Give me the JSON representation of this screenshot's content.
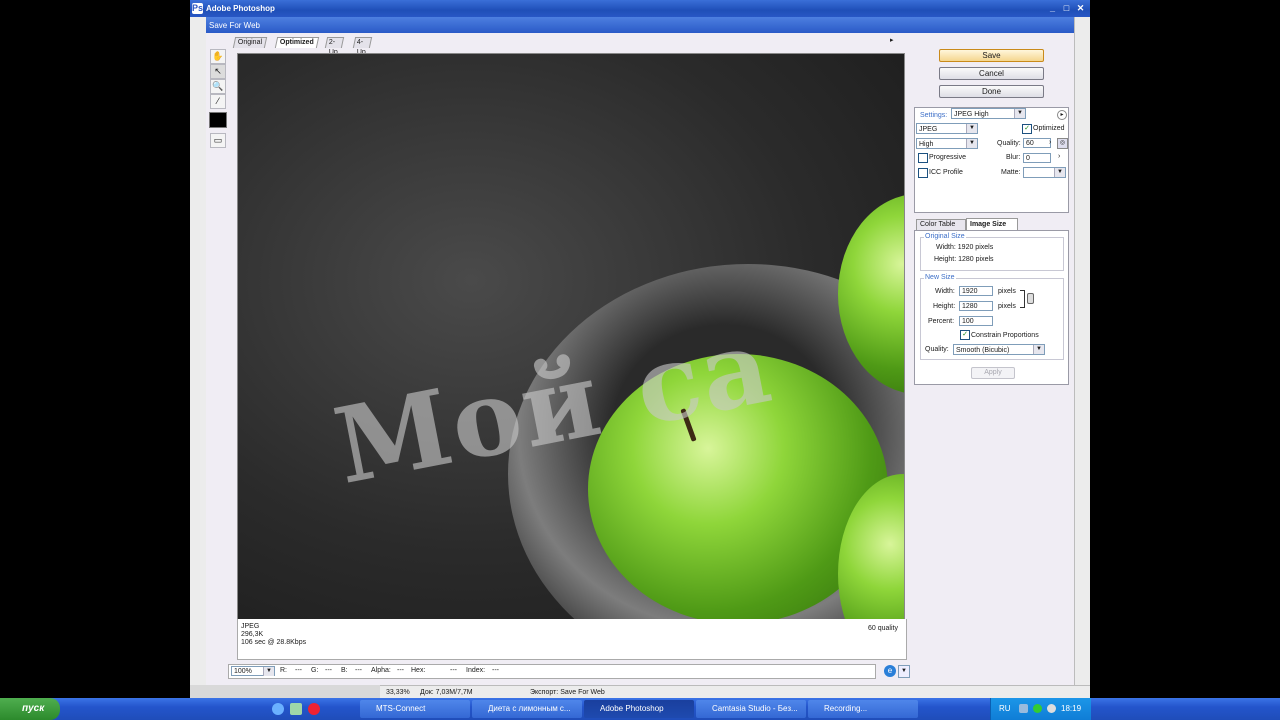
{
  "app": {
    "title": "Adobe Photoshop"
  },
  "dialog": {
    "title": "Save For Web",
    "tabs": [
      "Original",
      "Optimized",
      "2-Up",
      "4-Up"
    ],
    "preview": {
      "watermark": "Мой са"
    },
    "info_left": [
      "JPEG",
      "296,3K",
      "106 sec @ 28.8Kbps"
    ],
    "info_right": "60 quality",
    "status": {
      "zoom": "100%",
      "r_label": "R:",
      "r_val": "---",
      "g_label": "G:",
      "g_val": "---",
      "b_label": "B:",
      "b_val": "---",
      "alpha_label": "Alpha:",
      "alpha_val": "---",
      "hex_label": "Hex:",
      "hex_val": "---",
      "index_label": "Index:",
      "index_val": "---"
    },
    "buttons": {
      "save": "Save",
      "cancel": "Cancel",
      "done": "Done"
    },
    "settings": {
      "label": "Settings:",
      "preset": "JPEG High",
      "format": "JPEG",
      "optimized_label": "Optimized",
      "optimized_checked": true,
      "quality_level": "High",
      "quality_label": "Quality:",
      "quality_value": "60",
      "progressive_label": "Progressive",
      "blur_label": "Blur:",
      "blur_value": "0",
      "icc_label": "ICC Profile",
      "matte_label": "Matte:"
    },
    "image_size": {
      "tabs": [
        "Color Table",
        "Image Size"
      ],
      "original_size_label": "Original Size",
      "orig_width": "Width: 1920 pixels",
      "orig_height": "Height: 1280 pixels",
      "new_size_label": "New Size",
      "width_label": "Width:",
      "width_value": "1920",
      "height_label": "Height:",
      "height_value": "1280",
      "unit": "pixels",
      "percent_label": "Percent:",
      "percent_value": "100",
      "constrain_label": "Constrain Proportions",
      "constrain_checked": true,
      "quality_label": "Quality:",
      "quality_value": "Smooth (Bicubic)",
      "apply": "Apply"
    }
  },
  "docbar": {
    "zoom": "33,33%",
    "doc": "Док: 7,03M/7,7M",
    "hint": "Экспорт: Save For Web"
  },
  "taskbar": {
    "start": "пуск",
    "items": [
      "MTS-Connect",
      "Диета с лимонным с...",
      "Adobe Photoshop",
      "Camtasia Studio - Без...",
      "Recording..."
    ],
    "lang": "RU",
    "time": "18:19"
  }
}
